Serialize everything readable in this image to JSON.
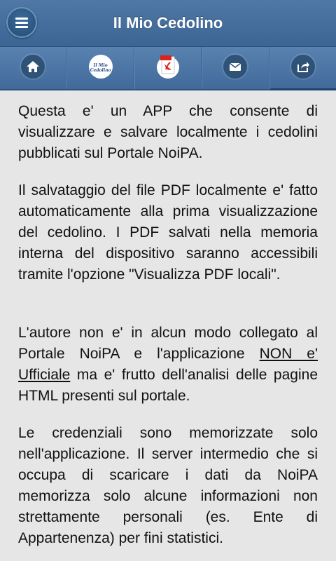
{
  "app": {
    "title": "Il Mio Cedolino"
  },
  "header": {
    "menu_icon": "hamburger-menu-icon"
  },
  "toolbar": {
    "items": [
      {
        "icon": "home-icon"
      },
      {
        "icon": "noipa-logo-icon",
        "logo_text": "Il Mio Cedolino"
      },
      {
        "icon": "pdf-icon",
        "pdf_text": "PDF"
      },
      {
        "icon": "mail-icon"
      },
      {
        "icon": "share-icon"
      }
    ]
  },
  "content": {
    "paragraph1": "Questa e' un APP che consente di visualizzare e salvare localmente i cedolini pubblicati sul Portale NoiPA.",
    "paragraph2": "Il salvataggio del file PDF localmente e' fatto automaticamente alla prima visualizzazione del cedolino. I PDF salvati nella memoria interna del dispositivo saranno accessibili tramite l'opzione \"Visualizza PDF locali\".",
    "paragraph3_before": "L'autore non e' in alcun modo collegato al Portale NoiPA e l'applicazione ",
    "paragraph3_underlined": "NON e' Ufficiale",
    "paragraph3_after": " ma e' frutto dell'analisi delle pagine HTML presenti sul portale.",
    "paragraph4": "Le credenziali sono memorizzate solo nell'applicazione. Il server intermedio che si occupa di scaricare i dati da NoiPA memorizza solo alcune informazioni non strettamente personali (es. Ente di Appartenenza) per fini statistici."
  }
}
